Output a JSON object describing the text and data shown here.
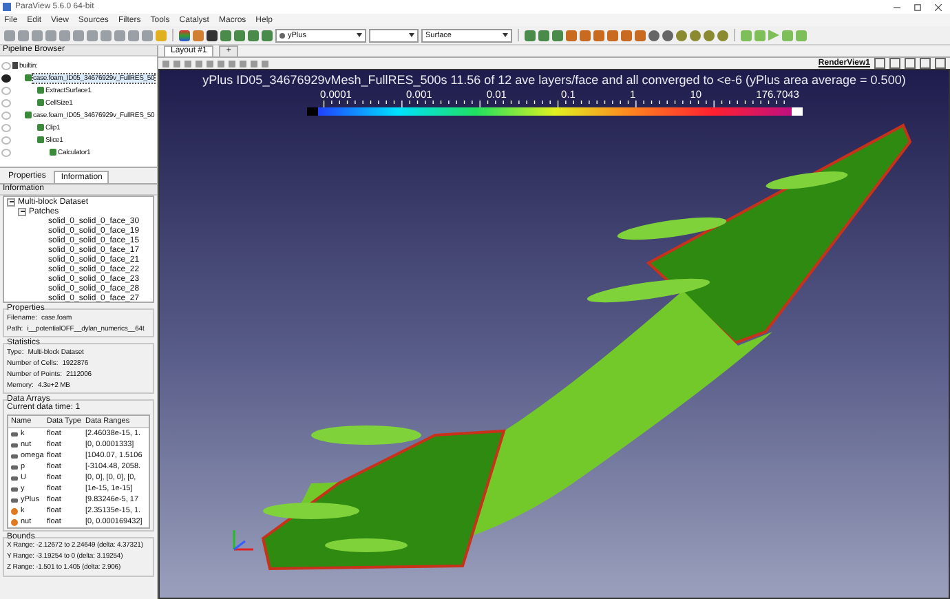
{
  "window": {
    "title": "ParaView 5.6.0 64-bit"
  },
  "menu": [
    "File",
    "Edit",
    "View",
    "Sources",
    "Filters",
    "Tools",
    "Catalyst",
    "Macros",
    "Help"
  ],
  "toolbar": {
    "array": "yPlus",
    "representation": "Surface"
  },
  "pipeline": {
    "title": "Pipeline Browser",
    "items": [
      {
        "label": "builtin:",
        "visible": false,
        "selected": false,
        "children": [
          {
            "label": "case.foam_ID05_34676929v_FullRES_50",
            "visible": true,
            "selected": true,
            "children": [
              {
                "label": "ExtractSurface1",
                "visible": false,
                "selected": false
              },
              {
                "label": "CellSize1",
                "visible": false,
                "selected": false
              }
            ]
          },
          {
            "label": "case.foam_ID05_34676929v_FullRES_50",
            "visible": false,
            "selected": false,
            "children": [
              {
                "label": "Clip1",
                "visible": false,
                "selected": false
              },
              {
                "label": "Slice1",
                "visible": false,
                "selected": false,
                "children": [
                  {
                    "label": "Calculator1",
                    "visible": false,
                    "selected": false
                  }
                ]
              }
            ]
          }
        ]
      }
    ]
  },
  "panel_tabs": [
    {
      "label": "Properties",
      "selected": false
    },
    {
      "label": "Information",
      "selected": true
    }
  ],
  "information": {
    "title": "Information",
    "hierarchy": {
      "label": "Multi-block Dataset",
      "children": [
        {
          "label": "Patches",
          "children": [
            {
              "label": "solid_0_solid_0_face_30"
            },
            {
              "label": "solid_0_solid_0_face_19"
            },
            {
              "label": "solid_0_solid_0_face_15"
            },
            {
              "label": "solid_0_solid_0_face_17"
            },
            {
              "label": "solid_0_solid_0_face_21"
            },
            {
              "label": "solid_0_solid_0_face_22"
            },
            {
              "label": "solid_0_solid_0_face_23"
            },
            {
              "label": "solid_0_solid_0_face_28"
            },
            {
              "label": "solid_0_solid_0_face_27"
            }
          ]
        }
      ]
    },
    "properties": {
      "title": "Properties",
      "rows": [
        {
          "label": "Filename:",
          "value": "case.foam"
        },
        {
          "label": "Path:",
          "value": "i__potentialOFF__dylan_numerics__64t"
        }
      ]
    },
    "statistics": {
      "title": "Statistics",
      "rows": [
        {
          "label": "Type:",
          "value": "Multi-block Dataset"
        },
        {
          "label": "Number of Cells:",
          "value": "1922876"
        },
        {
          "label": "Number of Points:",
          "value": "2112006"
        },
        {
          "label": "Memory:",
          "value": "4.3e+2 MB"
        }
      ]
    },
    "data_arrays": {
      "title": "Data Arrays",
      "current_time": "Current data time: 1",
      "columns": [
        "Name",
        "Data Type",
        "Data Ranges"
      ],
      "rows": [
        {
          "kind": "point",
          "name": "k",
          "type": "float",
          "range": "[2.46038e-15, 1."
        },
        {
          "kind": "point",
          "name": "nut",
          "type": "float",
          "range": "[0, 0.0001333]"
        },
        {
          "kind": "point",
          "name": "omega",
          "type": "float",
          "range": "[1040.07, 1.5106"
        },
        {
          "kind": "point",
          "name": "p",
          "type": "float",
          "range": "[-3104.48, 2058."
        },
        {
          "kind": "point",
          "name": "U",
          "type": "float",
          "range": "[0, 0], [0, 0], [0,"
        },
        {
          "kind": "point",
          "name": "y",
          "type": "float",
          "range": "[1e-15, 1e-15]"
        },
        {
          "kind": "point",
          "name": "yPlus",
          "type": "float",
          "range": "[9.83246e-5, 17"
        },
        {
          "kind": "cell",
          "name": "k",
          "type": "float",
          "range": "[2.35135e-15, 1."
        },
        {
          "kind": "cell",
          "name": "nut",
          "type": "float",
          "range": "[0, 0.000169432]"
        }
      ]
    },
    "bounds": {
      "title": "Bounds",
      "rows": [
        "X Range:  -2.12672 to 2.24649 (delta: 4.37321)",
        "Y Range:  -3.19254 to 0 (delta: 3.19254)",
        "Z Range:  -1.501 to 1.405 (delta: 2.906)"
      ]
    }
  },
  "layout_tabs": [
    {
      "label": "Layout #1",
      "selected": true
    },
    {
      "label": "+",
      "selected": false
    }
  ],
  "render_view": {
    "name": "RenderView1",
    "title": "yPlus ID05_34676929vMesh_FullRES_500s 11.56 of 12 ave layers/face and all converged to <e-6 (yPlus area average = 0.500)",
    "colorbar_labels": [
      "0.0001",
      "0.001",
      "0.01",
      "0.1",
      "1",
      "10",
      "176.7043"
    ]
  }
}
